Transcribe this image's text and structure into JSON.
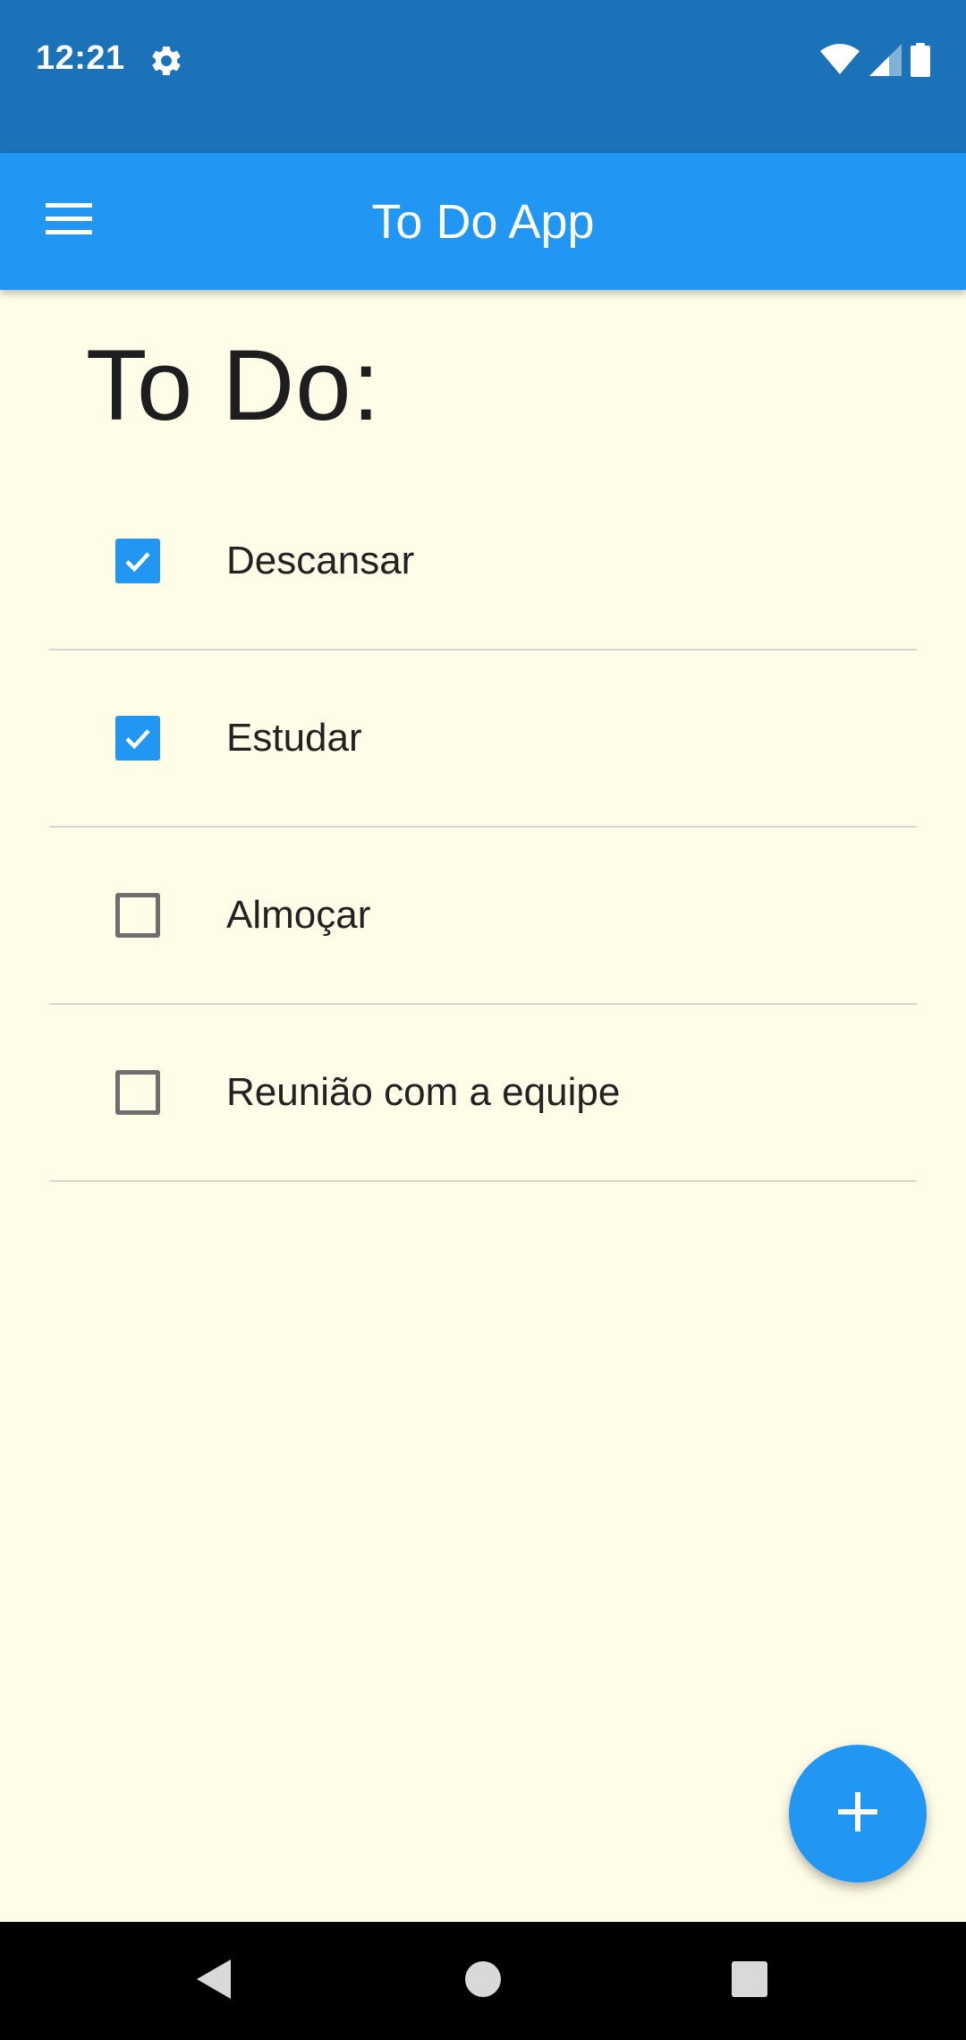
{
  "status_bar": {
    "time": "12:21",
    "icons": [
      "gear-icon",
      "wifi-icon",
      "cellular-signal-icon",
      "battery-icon"
    ]
  },
  "app_bar": {
    "title": "To Do App",
    "menu_icon": "hamburger-menu-icon"
  },
  "page": {
    "heading": "To Do:"
  },
  "todos": [
    {
      "label": "Descansar",
      "checked": true
    },
    {
      "label": "Estudar",
      "checked": true
    },
    {
      "label": "Almoçar",
      "checked": false
    },
    {
      "label": "Reunião com a equipe",
      "checked": false
    }
  ],
  "fab": {
    "icon": "plus-icon"
  },
  "nav_bar": {
    "icons": [
      "back-icon",
      "home-icon",
      "recents-icon"
    ]
  },
  "colors": {
    "status_bar": "#1C72B8",
    "app_bar": "#2196F3",
    "background": "#FFFDE7",
    "checkbox_checked": "#2196F3",
    "checkbox_unchecked_border": "#6E6E6E",
    "divider": "#D6D6CE",
    "fab": "#2196F3",
    "nav_bar": "#000000"
  }
}
